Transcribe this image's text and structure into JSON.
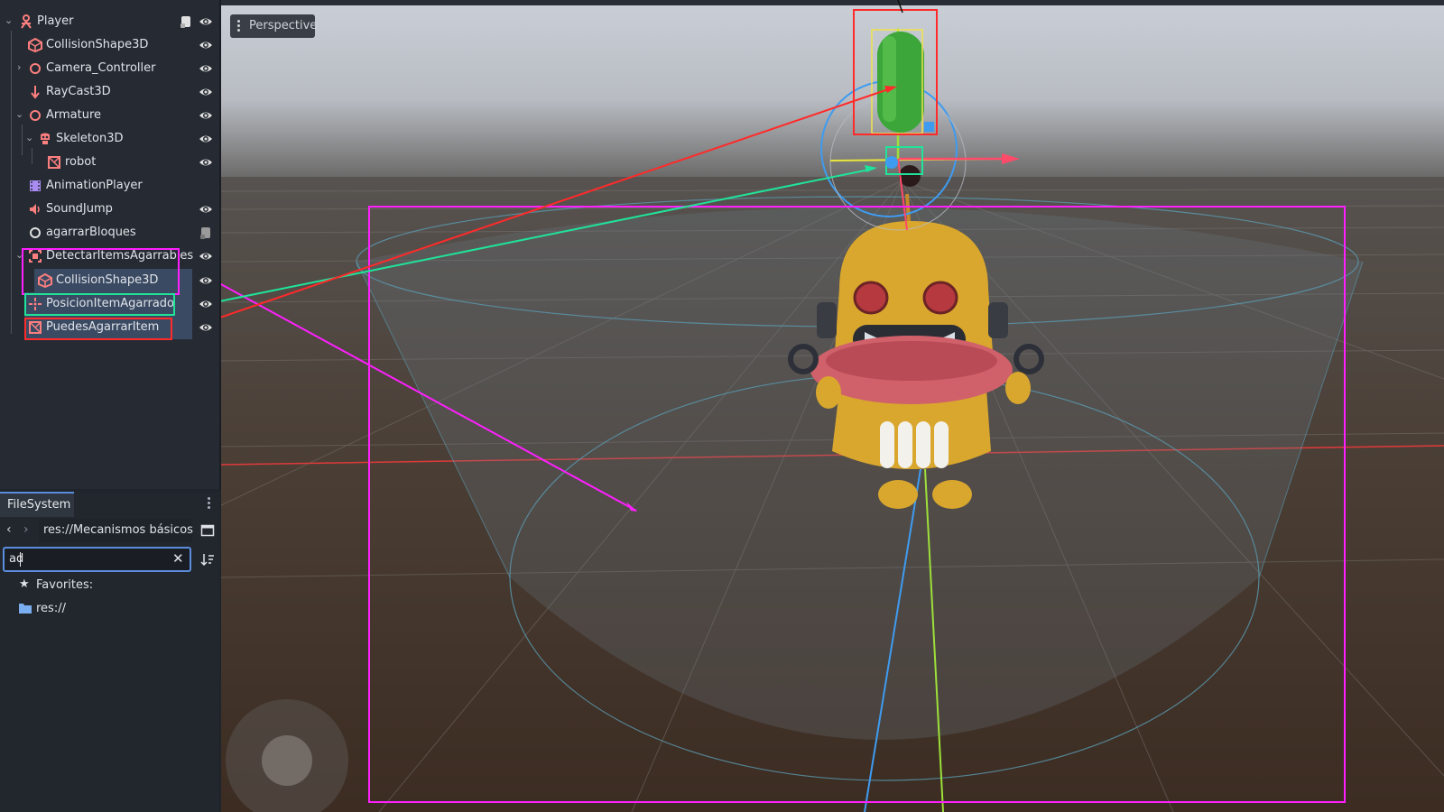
{
  "scene_tree": {
    "nodes": [
      {
        "label": "Player",
        "icon": "character-body-icon"
      },
      {
        "label": "CollisionShape3D",
        "icon": "collision-shape-icon"
      },
      {
        "label": "Camera_Controller",
        "icon": "node3d-icon"
      },
      {
        "label": "RayCast3D",
        "icon": "raycast-icon"
      },
      {
        "label": "Armature",
        "icon": "node3d-icon"
      },
      {
        "label": "Skeleton3D",
        "icon": "skeleton-icon"
      },
      {
        "label": "robot",
        "icon": "mesh-icon"
      },
      {
        "label": "AnimationPlayer",
        "icon": "animation-player-icon"
      },
      {
        "label": "SoundJump",
        "icon": "audio-player-icon"
      },
      {
        "label": "agarrarBloques",
        "icon": "node-icon"
      },
      {
        "label": "DetectarItemsAgarrables",
        "icon": "area3d-icon"
      },
      {
        "label": "CollisionShape3D",
        "icon": "collision-shape-icon"
      },
      {
        "label": "PosicionItemAgarrado",
        "icon": "marker3d-icon"
      },
      {
        "label": "PuedesAgarrarItem",
        "icon": "mesh-icon"
      }
    ]
  },
  "filesystem": {
    "tab_label": "FileSystem",
    "path": "res://Mecanismos básicos",
    "search_value": "ad",
    "favorites_label": "Favorites:",
    "root_label": "res://"
  },
  "viewport": {
    "perspective_label": "Perspective"
  },
  "colors": {
    "magenta": "#ff1fff",
    "cyan_green": "#20e39a",
    "red": "#ff2a2a",
    "selection": "#3b4a63"
  }
}
